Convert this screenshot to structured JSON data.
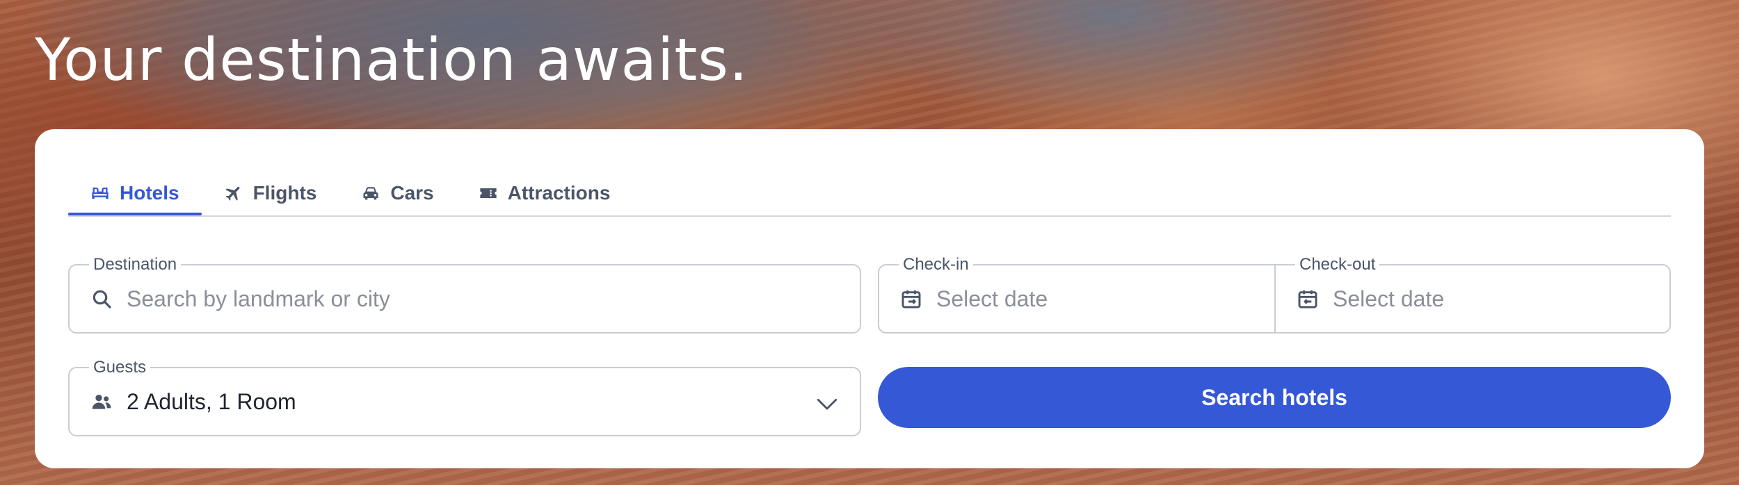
{
  "hero": {
    "title": "Your destination awaits."
  },
  "tabs": [
    {
      "label": "Hotels",
      "icon": "bed-icon",
      "active": true
    },
    {
      "label": "Flights",
      "icon": "airplane-icon",
      "active": false
    },
    {
      "label": "Cars",
      "icon": "car-icon",
      "active": false
    },
    {
      "label": "Attractions",
      "icon": "ticket-icon",
      "active": false
    }
  ],
  "destination": {
    "label": "Destination",
    "placeholder": "Search by landmark or city",
    "icon": "search-icon"
  },
  "checkin": {
    "label": "Check-in",
    "placeholder": "Select date",
    "icon": "calendar-checkin-icon"
  },
  "checkout": {
    "label": "Check-out",
    "placeholder": "Select date",
    "icon": "calendar-checkout-icon"
  },
  "guests": {
    "label": "Guests",
    "value": "2 Adults, 1 Room",
    "icon": "people-icon"
  },
  "search_button": {
    "label": "Search hotels"
  },
  "colors": {
    "accent": "#3558d6",
    "text": "#1f2430",
    "muted": "#8a8f99",
    "border": "#c9ccd3"
  }
}
